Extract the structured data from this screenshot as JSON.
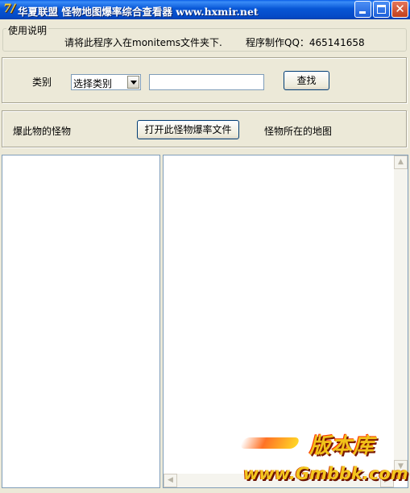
{
  "window": {
    "title": "华夏联盟 怪物地图爆率综合查看器 www.hxmir.net",
    "icon_glyph": "7/",
    "controls": {
      "minimize": "minimize-icon",
      "maximize": "maximize-icon",
      "close_glyph": "✕"
    }
  },
  "usage": {
    "legend": "使用说明",
    "instruction": "请将此程序入在monitems文件夹下.",
    "credit": "程序制作QQ：465141658"
  },
  "search": {
    "category_label": "类别",
    "category_selected": "选择类别",
    "keyword_value": "",
    "search_button": "查找"
  },
  "results": {
    "drops_label": "爆此物的怪物",
    "open_button": "打开此怪物爆率文件",
    "map_label": "怪物所在的地图"
  },
  "scrollbar": {
    "up": "▲",
    "down": "▼",
    "left": "◀",
    "right": "▶"
  },
  "watermark": {
    "logo": "版本库",
    "url": "www.Gmbbk.com"
  }
}
